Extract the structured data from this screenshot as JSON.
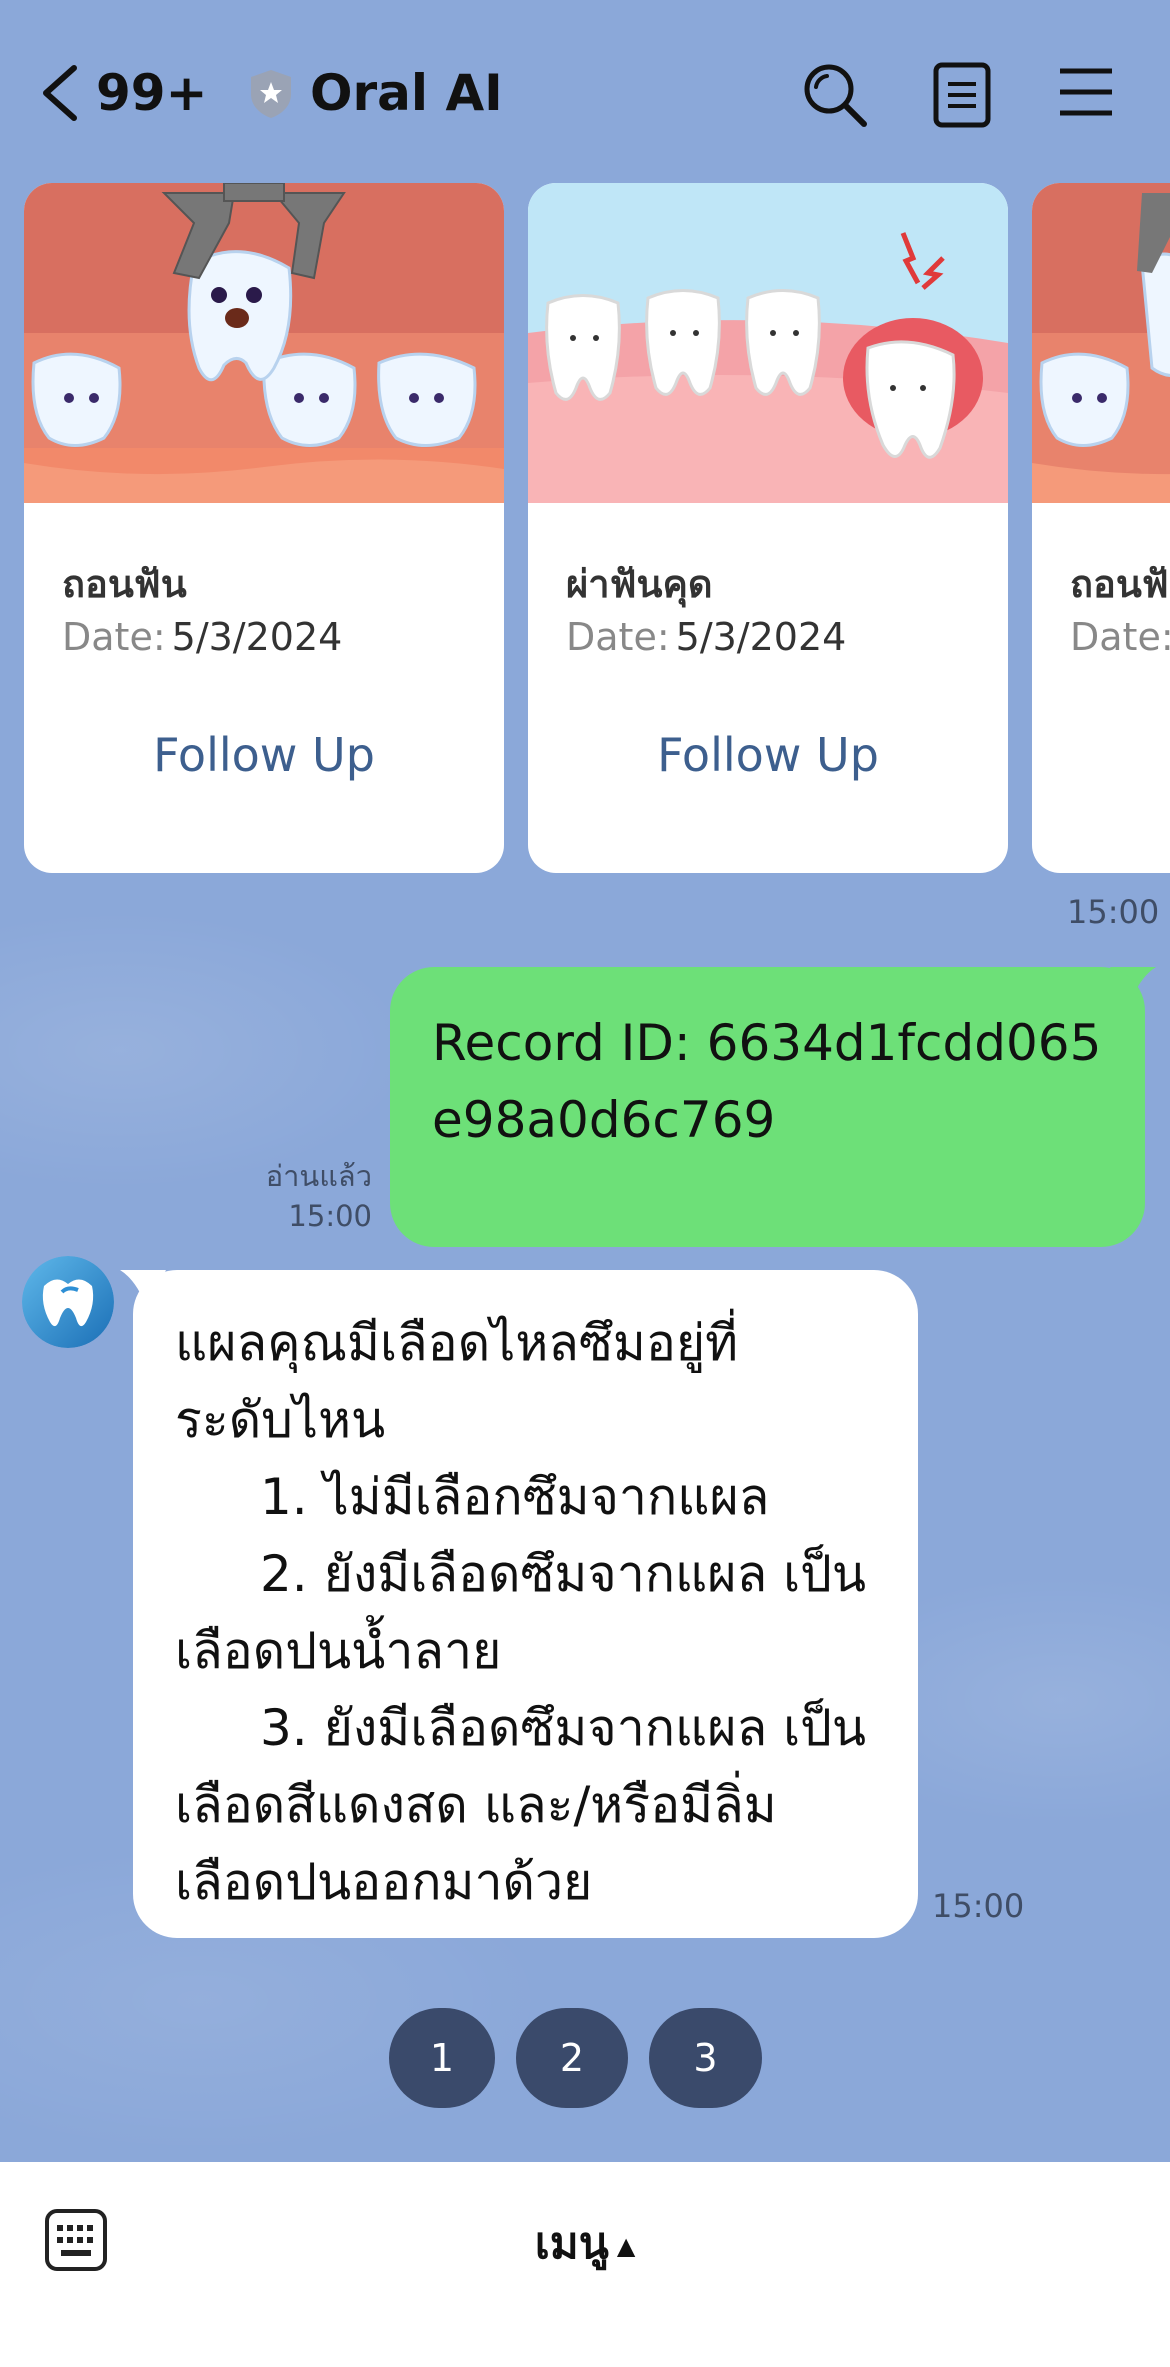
{
  "header": {
    "unread_count": "99+",
    "title": "Oral AI"
  },
  "cards": [
    {
      "title": "ถอนฟัน",
      "date_label": "Date:",
      "date": "5/3/2024",
      "button": "Follow Up"
    },
    {
      "title": "ผ่าฟันคุด",
      "date_label": "Date:",
      "date": "5/3/2024",
      "button": "Follow Up"
    },
    {
      "title": "ถอนฟั",
      "date_label": "Date:",
      "date": "",
      "button": ""
    }
  ],
  "carousel_time": "15:00",
  "outgoing": {
    "text": "Record ID: 6634d1fcdd065e98a0d6c769",
    "read_label": "อ่านแล้ว",
    "time": "15:00"
  },
  "incoming": {
    "line1": "แผลคุณมีเลือดไหลซึมอยู่ที่",
    "line2": "ระดับไหน",
    "opt1": "1. ไม่มีเลือกซึมจากแผล",
    "opt2a": "2. ยังมีเลือดซึมจากแผล เป็น",
    "opt2b": "เลือดปนน้ำลาย",
    "opt3a": "3. ยังมีเลือดซึมจากแผล เป็น",
    "opt3b": "เลือดสีแดงสด และ/หรือมีลิ่ม",
    "opt3c": "เลือดปนออกมาด้วย",
    "time": "15:00"
  },
  "quick_replies": [
    "1",
    "2",
    "3"
  ],
  "bottom": {
    "menu_label": "เมนู",
    "menu_arrow": "▲"
  },
  "colors": {
    "chat_bg": "#8ba8d9",
    "outgoing_bubble": "#6de078",
    "quick_reply": "#3a4a6b",
    "link": "#3d5f8e"
  }
}
